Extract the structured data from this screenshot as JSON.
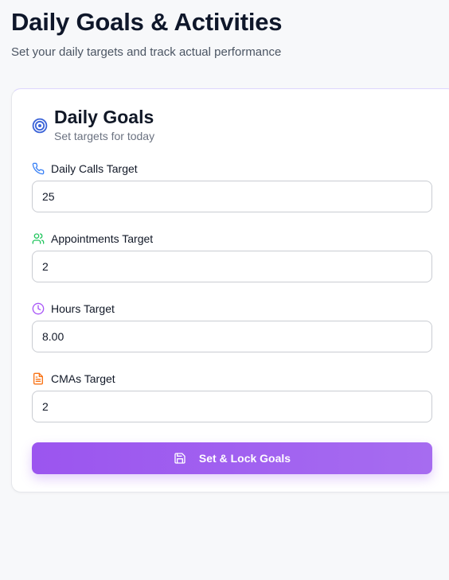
{
  "page": {
    "title": "Daily Goals & Activities",
    "subtitle": "Set your daily targets and track actual performance"
  },
  "card": {
    "title": "Daily Goals",
    "subtitle": "Set targets for today",
    "icon": "target-icon",
    "fields": [
      {
        "label": "Daily Calls Target",
        "value": "25",
        "icon": "phone-icon",
        "icon_color": "#3b82f6"
      },
      {
        "label": "Appointments Target",
        "value": "2",
        "icon": "users-icon",
        "icon_color": "#22c55e"
      },
      {
        "label": "Hours Target",
        "value": "8.00",
        "icon": "clock-icon",
        "icon_color": "#a855f7"
      },
      {
        "label": "CMAs Target",
        "value": "2",
        "icon": "file-text-icon",
        "icon_color": "#f97316"
      }
    ],
    "submit": {
      "label": "Set & Lock Goals",
      "icon": "save-icon"
    }
  },
  "colors": {
    "accent": "#9b55ef",
    "accent_light": "#a66cf0",
    "target_icon": "#3b63d8"
  }
}
